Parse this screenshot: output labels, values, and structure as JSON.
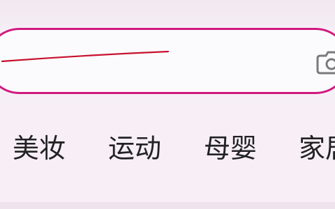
{
  "search": {
    "placeholder": "",
    "value": ""
  },
  "icons": {
    "camera": "camera-icon"
  },
  "colors": {
    "accent": "#d1197e",
    "stroke": "#c8102e",
    "background": "#f7eff6",
    "search_bg": "#fbfbfd",
    "text": "#222222"
  },
  "categories": [
    {
      "label": "美妆"
    },
    {
      "label": "运动"
    },
    {
      "label": "母婴"
    },
    {
      "label": "家居"
    }
  ]
}
